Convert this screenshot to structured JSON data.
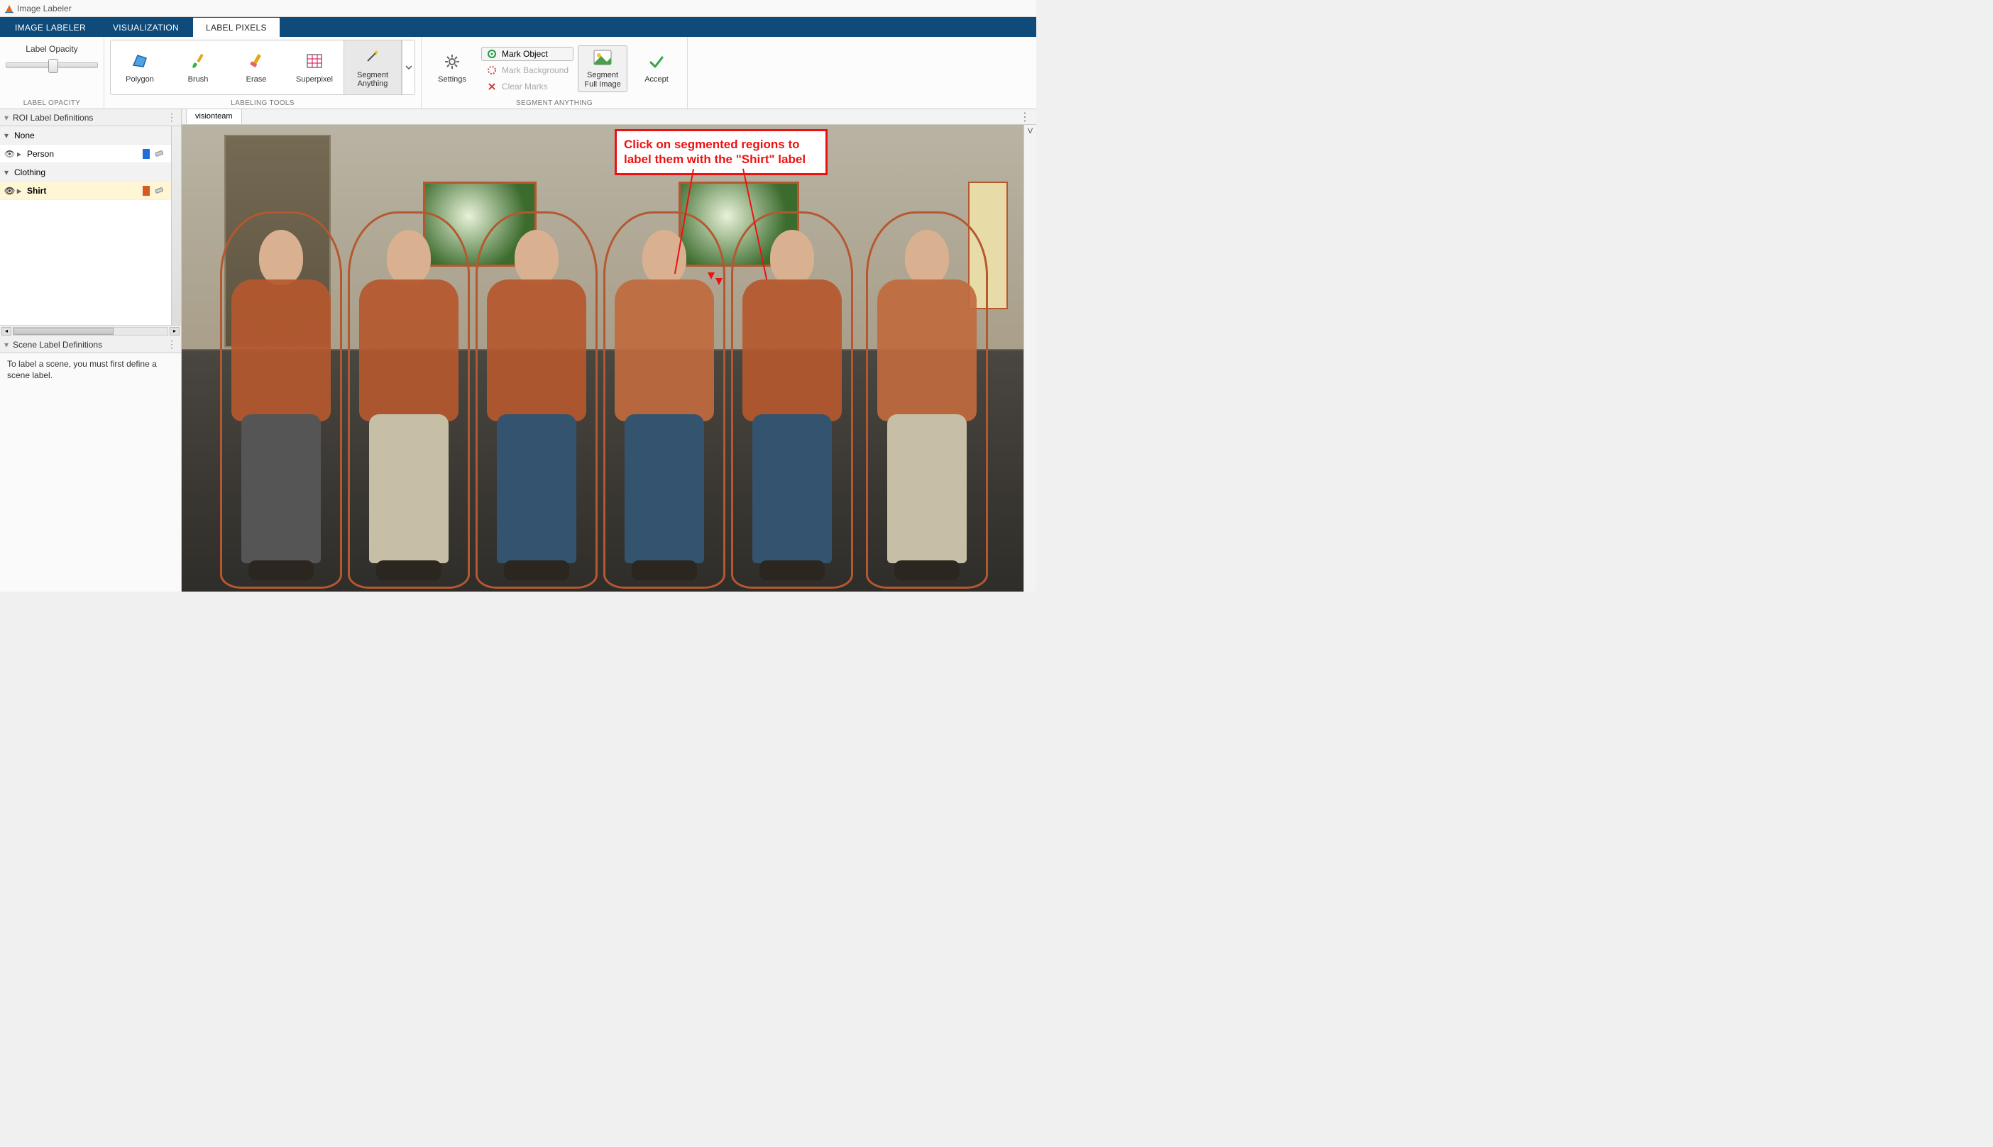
{
  "window": {
    "title": "Image Labeler"
  },
  "tabs": {
    "image_labeler": "IMAGE LABELER",
    "visualization": "VISUALIZATION",
    "label_pixels": "LABEL PIXELS"
  },
  "ribbon": {
    "label_opacity": {
      "label": "Label Opacity",
      "group": "LABEL OPACITY"
    },
    "tools": {
      "polygon": "Polygon",
      "brush": "Brush",
      "erase": "Erase",
      "superpixel": "Superpixel",
      "segment_anything": "Segment\nAnything",
      "group": "LABELING TOOLS"
    },
    "segment_anything": {
      "settings": "Settings",
      "mark_object": "Mark Object",
      "mark_background": "Mark Background",
      "clear_marks": "Clear Marks",
      "segment_full_image": "Segment\nFull Image",
      "accept": "Accept",
      "group": "SEGMENT ANYTHING"
    }
  },
  "panels": {
    "roi_title": "ROI Label Definitions",
    "scene_title": "Scene Label Definitions",
    "scene_msg": "To label a scene, you must first define a scene label."
  },
  "labels": {
    "groups": {
      "none": "None",
      "clothing": "Clothing"
    },
    "items": {
      "person": {
        "name": "Person",
        "swatch": "#1f6fd9"
      },
      "shirt": {
        "name": "Shirt",
        "swatch": "#d65a26"
      }
    }
  },
  "document": {
    "tab": "visionteam"
  },
  "callout": {
    "line1": "Click on segmented regions to",
    "line2": "label them with the \"Shirt\" label"
  },
  "right_strip": "V"
}
